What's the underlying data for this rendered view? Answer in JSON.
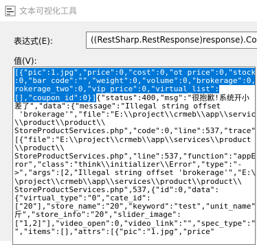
{
  "window": {
    "title": "文本可视化工具"
  },
  "expression": {
    "label": "表达式(E):",
    "value": "((RestSharp.RestResponse)response).Cont"
  },
  "value": {
    "label": "值(V):",
    "selected_text": "[{\"pic\":1.jpg\",\"price\":0,\"cost\":0,\"ot_price\":0,\"stock\"\n:0,\"bar_code\":\"\",\"weight\":0,\"volume\":0,\"brokerage\":0,\"b\nrokerage_two\":0,\"vip_price\":0,\"virtual_list\":\n[],\"coupon_id\":0}]",
    "unselected_text": "{\"status\":400,\"msg\":\"很抱歉!系统开小\n差了\",\"data\":{\"message\":\"Illegal string offset\n 'brokerage'\",\"file\":\"E:\\\\project\\\\crmeb\\\\app\\\\services\n\\\\product\\\\product\\\\\nStoreProductServices.php\",\"code\":0,\"line\":537,\"trace\":\n[{\"file\":\"E:\\\\project\\\\crmeb\\\\app\\\\services\\\\product\n\\\\product\\\\\nStoreProductServices.php\",\"line\":537,\"function\":\"appEr\nror\",\"class\":\"think\\\\initializer\\\\Error\",\"type\":\"-\n>\",\"args\":[2,\"Illegal string offset 'brokerage'\",\"E:\\\n\\project\\\\crmeb\\\\app\\\\services\\\\product\\\\product\\\\\nStoreProductServices.php\",537,{\"id\":0,\"data\":\n{\"virtual_type\":\"0\",\"cate_id\":\n[\"20\"],\"store_name\":\"20\",\"keyword\":\"test\",\"unit_name\":\"\n斤\",\"store_info\":\"20\",\"slider_image\":\n[\"1,2]\"],\"video_open\":0,\"video_link\":\"\",\"spec_type\":\"0\n\",\"items\":[],\"attrs\":[{\"pic\":\"1.jpg\",\"price\""
  },
  "icons": {
    "app": "visualizer-app-icon"
  }
}
